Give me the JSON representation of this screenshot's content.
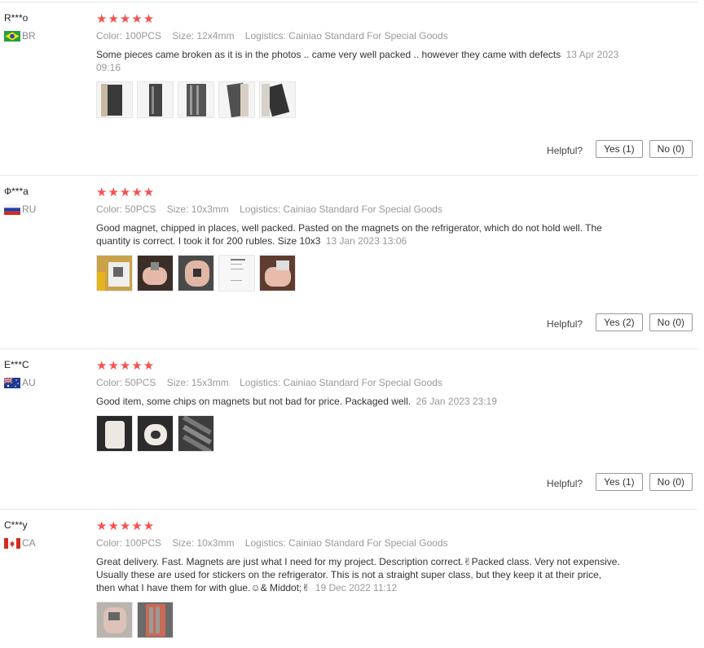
{
  "reviews": [
    {
      "user": "R***o",
      "country_code": "BR",
      "stars": "★★★★★",
      "color_label": "Color:",
      "color": "100PCS",
      "size_label": "Size:",
      "size": "12x4mm",
      "logistics_label": "Logistics:",
      "logistics": "Cainiao Standard For Special Goods",
      "text": "Some pieces came broken as it is in the photos .. came very well packed .. however they came with defects",
      "date": "13 Apr 2023 09:16",
      "helpful_label": "Helpful?",
      "yes_label": "Yes (1)",
      "no_label": "No (0)"
    },
    {
      "user": "Ф***а",
      "country_code": "RU",
      "stars": "★★★★★",
      "color_label": "Color:",
      "color": "50PCS",
      "size_label": "Size:",
      "size": "10x3mm",
      "logistics_label": "Logistics:",
      "logistics": "Cainiao Standard For Special Goods",
      "text": "Good magnet, chipped in places, well packed. Pasted on the magnets on the refrigerator, which do not hold well. The quantity is correct. I took it for 200 rubles. Size 10x3",
      "date": "13 Jan 2023 13:06",
      "helpful_label": "Helpful?",
      "yes_label": "Yes (2)",
      "no_label": "No (0)"
    },
    {
      "user": "E***C",
      "country_code": "AU",
      "stars": "★★★★★",
      "color_label": "Color:",
      "color": "50PCS",
      "size_label": "Size:",
      "size": "15x3mm",
      "logistics_label": "Logistics:",
      "logistics": "Cainiao Standard For Special Goods",
      "text": "Good item, some chips on magnets but not bad for price. Packaged well.",
      "date": "26 Jan 2023 23:19",
      "helpful_label": "Helpful?",
      "yes_label": "Yes (1)",
      "no_label": "No (0)"
    },
    {
      "user": "C***y",
      "country_code": "CA",
      "stars": "★★★★★",
      "color_label": "Color:",
      "color": "100PCS",
      "size_label": "Size:",
      "size": "10x3mm",
      "logistics_label": "Logistics:",
      "logistics": "Cainiao Standard For Special Goods",
      "text": "Great delivery. Fast. Magnets are just what I need for my project. Description correct.✌Packed class. Very not expensive. Usually these are used for stickers on the refrigerator. This is not a straight super class, but they keep it at their price, then what I have them for with glue.☺& Middot;✌",
      "date": "19 Dec 2022 11:12",
      "helpful_label": "",
      "yes_label": "",
      "no_label": ""
    }
  ],
  "colors": {
    "star": "#f7514f",
    "muted": "#999999",
    "divider": "#e8e8e8"
  }
}
